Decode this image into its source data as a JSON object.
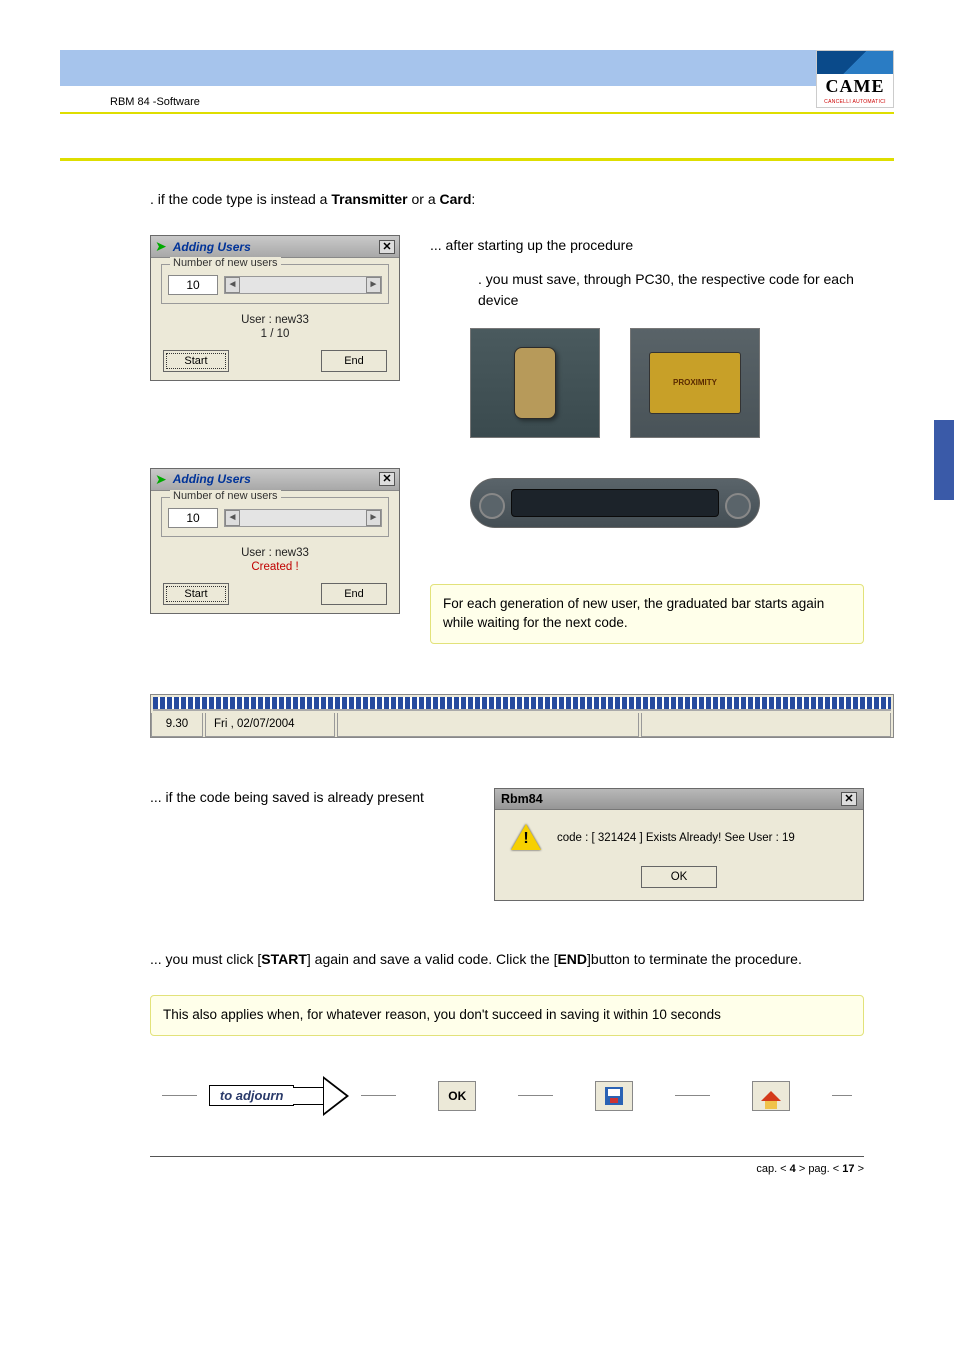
{
  "header": {
    "doc_title": "RBM 84 -Software",
    "logo_text": "CAME",
    "logo_sub": "CANCELLI AUTOMATICI"
  },
  "intro": {
    "line1_prefix": ". if the code type is instead a ",
    "bold1": "Transmitter",
    "mid": " or a ",
    "bold2": "Card",
    "suffix": ":"
  },
  "right1": {
    "line1": "... after starting up the procedure",
    "line2": ". you must save, through PC30, the respective code for each device"
  },
  "dialog1": {
    "title": "Adding Users",
    "legend": "Number of new users",
    "value": "10",
    "user_line": "User : new33",
    "progress": "1 / 10",
    "start": "Start",
    "end": "End"
  },
  "dialog2": {
    "title": "Adding Users",
    "legend": "Number of new users",
    "value": "10",
    "user_line": "User : new33",
    "created": "Created !",
    "start": "Start",
    "end": "End"
  },
  "note1": "For each generation of new user, the graduated bar starts again while waiting for the next code.",
  "statusbar": {
    "time": "9.30",
    "date": "Fri , 02/07/2004"
  },
  "para2": "... if the code being saved is already present",
  "msgbox": {
    "title": "Rbm84",
    "text": "code : [ 321424 ] Exists Already! See User :  19",
    "ok": "OK"
  },
  "para3": {
    "pre": "... you must click [",
    "b1": "START",
    "mid": "] again and save a valid code.  Click the [",
    "b2": "END",
    "post": "]button to terminate the procedure."
  },
  "note2": "This also applies when, for whatever reason, you don't succeed in saving it within 10 seconds",
  "adjourn": "to adjourn",
  "ok_btn": "OK",
  "footer": {
    "pre": "cap. < ",
    "cap": "4",
    "mid": " > pag. < ",
    "pag": "17",
    "post": " >"
  }
}
